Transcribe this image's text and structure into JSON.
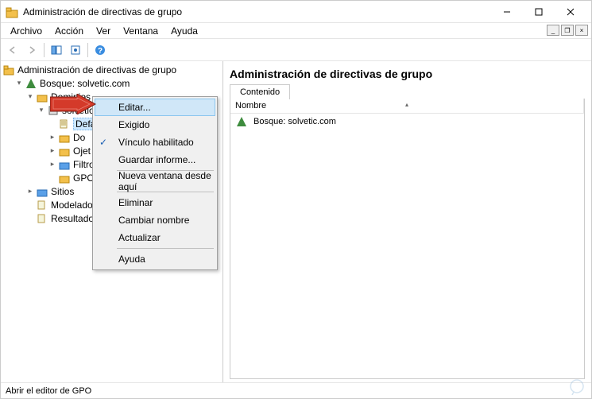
{
  "title": "Administración de directivas de grupo",
  "menus": {
    "archivo": "Archivo",
    "accion": "Acción",
    "ver": "Ver",
    "ventana": "Ventana",
    "ayuda": "Ayuda"
  },
  "tree": {
    "root": "Administración de directivas de grupo",
    "forest": "Bosque: solvetic.com",
    "domains": "Dominios",
    "domain": "solvetic.com",
    "default_policy": "Default Domain Policy",
    "domain_controllers_trunc": "Do",
    "objects_trunc": "Ojet",
    "filters_trunc": "Filtros",
    "gpo_trunc": "GPO d",
    "sites": "Sitios",
    "modelado_trunc": "Modelado de",
    "resultados_trunc": "Resultados d"
  },
  "content": {
    "heading": "Administración de directivas de grupo",
    "tab": "Contenido",
    "col_name": "Nombre",
    "row1_trunc": "Bosque: solvetic.com"
  },
  "context_menu": {
    "editar": "Editar...",
    "exigido": "Exigido",
    "vinculo": "Vínculo habilitado",
    "guardar": "Guardar informe...",
    "nueva_ventana": "Nueva ventana desde aquí",
    "eliminar": "Eliminar",
    "cambiar_nombre": "Cambiar nombre",
    "actualizar": "Actualizar",
    "ayuda": "Ayuda"
  },
  "statusbar": "Abrir el editor de GPO"
}
